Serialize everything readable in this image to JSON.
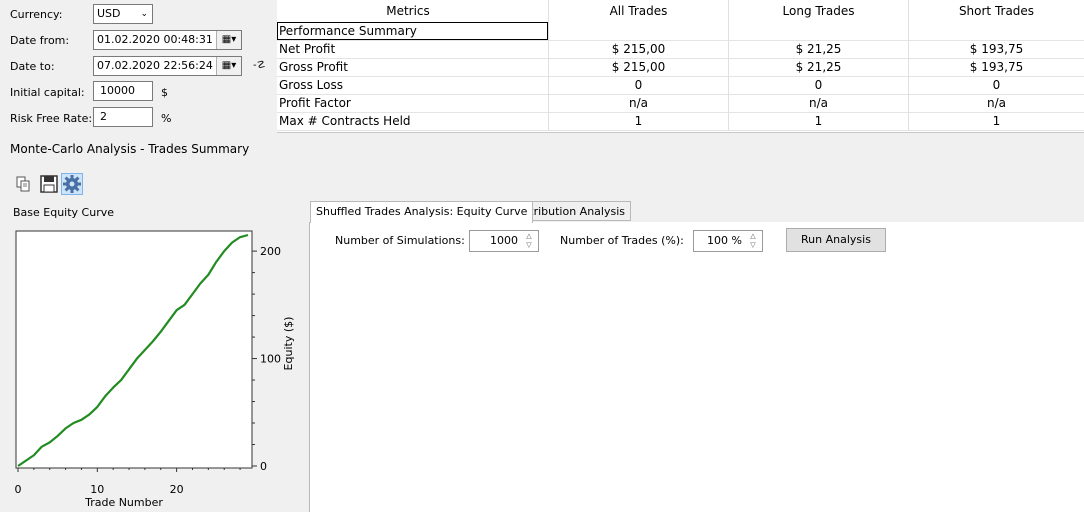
{
  "settings": {
    "currency_label": "Currency:",
    "currency_value": "USD",
    "date_from_label": "Date from:",
    "date_from_value": "01.02.2020 00:48:31",
    "date_to_label": "Date to:",
    "date_to_value": "07.02.2020 22:56:24",
    "initial_capital_label": "Initial capital:",
    "initial_capital_value": "10000",
    "initial_capital_unit": "$",
    "risk_free_label": "Risk Free Rate:",
    "risk_free_value": "2",
    "risk_free_unit": "%"
  },
  "metrics": {
    "headers": [
      "Metrics",
      "All Trades",
      "Long Trades",
      "Short Trades"
    ],
    "rows": [
      [
        "Performance Summary",
        "",
        "",
        ""
      ],
      [
        "Net Profit",
        "$ 215,00",
        "$ 21,25",
        "$ 193,75"
      ],
      [
        "Gross Profit",
        "$ 215,00",
        "$ 21,25",
        "$ 193,75"
      ],
      [
        "Gross Loss",
        "0",
        "0",
        "0"
      ],
      [
        "Profit Factor",
        "n/a",
        "n/a",
        "n/a"
      ],
      [
        "Max # Contracts Held",
        "1",
        "1",
        "1"
      ]
    ]
  },
  "monte_carlo": {
    "title": "Monte-Carlo Analysis - Trades Summary",
    "toolbar": [
      "copy-icon",
      "save-icon",
      "settings-gear-icon"
    ]
  },
  "chart_data": {
    "type": "line",
    "title": "Base Equity Curve",
    "xlabel": "Trade Number",
    "ylabel": "Equity ($)",
    "xlim": [
      0,
      29
    ],
    "ylim": [
      0,
      215
    ],
    "xticks": [
      "0",
      "10",
      "20"
    ],
    "yticks": [
      "0",
      "100",
      "200"
    ],
    "x": [
      0,
      1,
      2,
      3,
      4,
      5,
      6,
      7,
      8,
      9,
      10,
      11,
      12,
      13,
      14,
      15,
      16,
      17,
      18,
      19,
      20,
      21,
      22,
      23,
      24,
      25,
      26,
      27,
      28,
      29
    ],
    "y": [
      0,
      5,
      10,
      18,
      22,
      28,
      35,
      40,
      43,
      48,
      55,
      65,
      73,
      80,
      90,
      100,
      108,
      116,
      125,
      135,
      145,
      150,
      160,
      170,
      178,
      190,
      200,
      208,
      213,
      215
    ],
    "color": "#228b22",
    "grid": false
  },
  "tabs": [
    {
      "label": "Shuffled Trades Analysis: Equity Curve",
      "active": true
    },
    {
      "label": "Distribution Analysis",
      "active": false
    }
  ],
  "analysis": {
    "simulations_label": "Number of Simulations:",
    "simulations_value": "1000",
    "trades_label": "Number of Trades (%):",
    "trades_value": "100 %",
    "run_button": "Run Analysis"
  },
  "colors": {
    "accent": "#cce4f7",
    "line": "#228b22"
  }
}
